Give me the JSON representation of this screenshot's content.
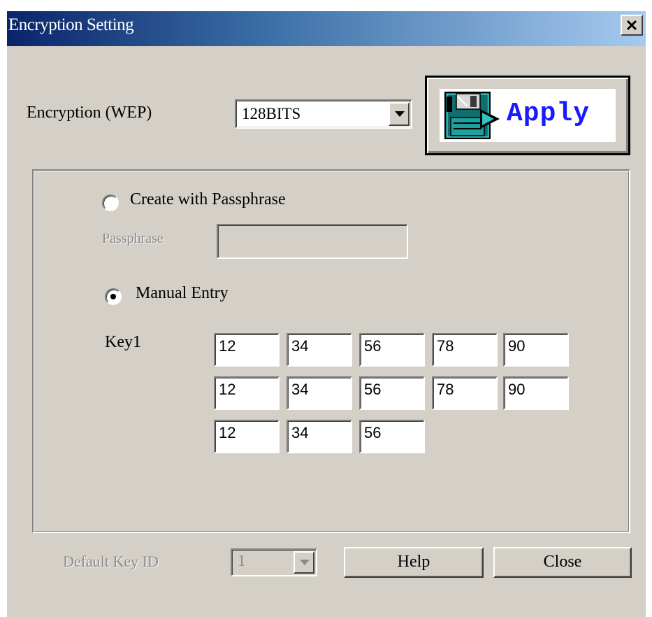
{
  "window": {
    "title": "Encryption Setting",
    "close_glyph": "×"
  },
  "encryption": {
    "label": "Encryption (WEP)",
    "selected": "128BITS",
    "apply_label": "Apply",
    "apply_icon": "floppy-disk-icon"
  },
  "passphrase_mode": {
    "label": "Create with Passphrase",
    "selected": false,
    "field_label": "Passphrase",
    "value": ""
  },
  "manual_mode": {
    "label": "Manual Entry",
    "selected": true,
    "key_label": "Key1",
    "key_bytes": [
      "12",
      "34",
      "56",
      "78",
      "90",
      "12",
      "34",
      "56",
      "78",
      "90",
      "12",
      "34",
      "56"
    ]
  },
  "default_key": {
    "label": "Default Key ID",
    "selected": "1",
    "enabled": false
  },
  "buttons": {
    "help": "Help",
    "close": "Close"
  },
  "colors": {
    "face": "#d4d0c8",
    "title_start": "#0a246a",
    "title_end": "#a6caf0",
    "apply_text": "#1a1aff",
    "disabled_text": "#8a8a8a"
  }
}
